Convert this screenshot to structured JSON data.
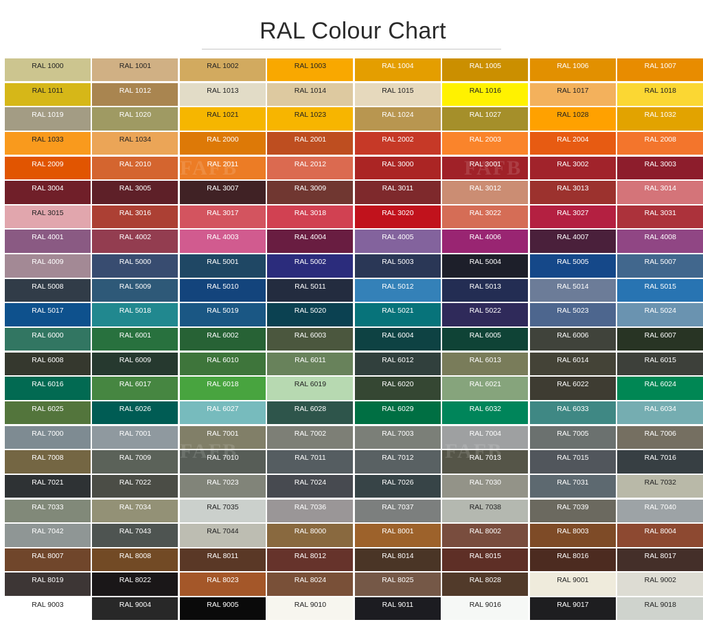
{
  "page": {
    "title": "RAL Colour Chart",
    "watermark_text": "FAFB"
  },
  "swatches": [
    {
      "label": "RAL 1000",
      "color": "#ccc58f",
      "text": "#222222"
    },
    {
      "label": "RAL 1001",
      "color": "#d0b084",
      "text": "#222222"
    },
    {
      "label": "RAL 1002",
      "color": "#d2aa5f",
      "text": "#222222"
    },
    {
      "label": "RAL 1003",
      "color": "#f9a800",
      "text": "#222222"
    },
    {
      "label": "RAL 1004",
      "color": "#e49e00",
      "text": "#ffffff"
    },
    {
      "label": "RAL 1005",
      "color": "#cb8f00",
      "text": "#ffffff"
    },
    {
      "label": "RAL 1006",
      "color": "#e29000",
      "text": "#ffffff"
    },
    {
      "label": "RAL 1007",
      "color": "#e88c00",
      "text": "#ffffff"
    },
    {
      "label": "RAL 1011",
      "color": "#d6b718",
      "text": "#222222"
    },
    {
      "label": "RAL 1012",
      "color": "#a98550",
      "text": "#ffffff"
    },
    {
      "label": "RAL 1013",
      "color": "#e2dcc7",
      "text": "#222222"
    },
    {
      "label": "RAL 1014",
      "color": "#ddc9a0",
      "text": "#222222"
    },
    {
      "label": "RAL 1015",
      "color": "#e6d9bd",
      "text": "#222222"
    },
    {
      "label": "RAL 1016",
      "color": "#fff200",
      "text": "#222222"
    },
    {
      "label": "RAL 1017",
      "color": "#f3b15c",
      "text": "#222222"
    },
    {
      "label": "RAL 1018",
      "color": "#fbd733",
      "text": "#222222"
    },
    {
      "label": "RAL 1019",
      "color": "#a39c84",
      "text": "#ffffff"
    },
    {
      "label": "RAL 1020",
      "color": "#9f9a63",
      "text": "#ffffff"
    },
    {
      "label": "RAL 1021",
      "color": "#f6b600",
      "text": "#222222"
    },
    {
      "label": "RAL 1023",
      "color": "#f7b500",
      "text": "#222222"
    },
    {
      "label": "RAL 1024",
      "color": "#b89650",
      "text": "#ffffff"
    },
    {
      "label": "RAL 1027",
      "color": "#a58f2a",
      "text": "#ffffff"
    },
    {
      "label": "RAL 1028",
      "color": "#ffa100",
      "text": "#222222"
    },
    {
      "label": "RAL 1032",
      "color": "#e2a300",
      "text": "#ffffff"
    },
    {
      "label": "RAL 1033",
      "color": "#f99a1d",
      "text": "#222222"
    },
    {
      "label": "RAL 1034",
      "color": "#eba557",
      "text": "#222222"
    },
    {
      "label": "RAL 2000",
      "color": "#dd7907",
      "text": "#ffffff"
    },
    {
      "label": "RAL 2001",
      "color": "#be4e20",
      "text": "#ffffff"
    },
    {
      "label": "RAL 2002",
      "color": "#c63927",
      "text": "#ffffff"
    },
    {
      "label": "RAL 2003",
      "color": "#fa842b",
      "text": "#ffffff"
    },
    {
      "label": "RAL 2004",
      "color": "#e75b12",
      "text": "#ffffff"
    },
    {
      "label": "RAL 2008",
      "color": "#f3752c",
      "text": "#ffffff"
    },
    {
      "label": "RAL 2009",
      "color": "#e15501",
      "text": "#ffffff"
    },
    {
      "label": "RAL 2010",
      "color": "#d4652f",
      "text": "#ffffff"
    },
    {
      "label": "RAL 2011",
      "color": "#ec7c25",
      "text": "#ffffff"
    },
    {
      "label": "RAL 2012",
      "color": "#db6a50",
      "text": "#ffffff"
    },
    {
      "label": "RAL 3000",
      "color": "#ab2524",
      "text": "#ffffff"
    },
    {
      "label": "RAL 3001",
      "color": "#a02128",
      "text": "#ffffff"
    },
    {
      "label": "RAL 3002",
      "color": "#a1232b",
      "text": "#ffffff"
    },
    {
      "label": "RAL 3003",
      "color": "#8d1d2c",
      "text": "#ffffff"
    },
    {
      "label": "RAL 3004",
      "color": "#701f29",
      "text": "#ffffff"
    },
    {
      "label": "RAL 3005",
      "color": "#5e2028",
      "text": "#ffffff"
    },
    {
      "label": "RAL 3007",
      "color": "#402225",
      "text": "#ffffff"
    },
    {
      "label": "RAL 3009",
      "color": "#703731",
      "text": "#ffffff"
    },
    {
      "label": "RAL 3011",
      "color": "#7e292c",
      "text": "#ffffff"
    },
    {
      "label": "RAL 3012",
      "color": "#cb8d73",
      "text": "#ffffff"
    },
    {
      "label": "RAL 3013",
      "color": "#9c322e",
      "text": "#ffffff"
    },
    {
      "label": "RAL 3014",
      "color": "#d47479",
      "text": "#ffffff"
    },
    {
      "label": "RAL 3015",
      "color": "#e1a6ad",
      "text": "#222222"
    },
    {
      "label": "RAL 3016",
      "color": "#ac4034",
      "text": "#ffffff"
    },
    {
      "label": "RAL 3017",
      "color": "#d3545f",
      "text": "#ffffff"
    },
    {
      "label": "RAL 3018",
      "color": "#d14152",
      "text": "#ffffff"
    },
    {
      "label": "RAL 3020",
      "color": "#c1121c",
      "text": "#ffffff"
    },
    {
      "label": "RAL 3022",
      "color": "#d56d56",
      "text": "#ffffff"
    },
    {
      "label": "RAL 3027",
      "color": "#b42041",
      "text": "#ffffff"
    },
    {
      "label": "RAL 3031",
      "color": "#ac323b",
      "text": "#ffffff"
    },
    {
      "label": "RAL 4001",
      "color": "#8a5a83",
      "text": "#ffffff"
    },
    {
      "label": "RAL 4002",
      "color": "#933d50",
      "text": "#ffffff"
    },
    {
      "label": "RAL 4003",
      "color": "#d15b8f",
      "text": "#ffffff"
    },
    {
      "label": "RAL 4004",
      "color": "#691d41",
      "text": "#ffffff"
    },
    {
      "label": "RAL 4005",
      "color": "#83639d",
      "text": "#ffffff"
    },
    {
      "label": "RAL 4006",
      "color": "#992572",
      "text": "#ffffff"
    },
    {
      "label": "RAL 4007",
      "color": "#4a203b",
      "text": "#ffffff"
    },
    {
      "label": "RAL 4008",
      "color": "#904684",
      "text": "#ffffff"
    },
    {
      "label": "RAL 4009",
      "color": "#a38995",
      "text": "#ffffff"
    },
    {
      "label": "RAL 5000",
      "color": "#384c70",
      "text": "#ffffff"
    },
    {
      "label": "RAL 5001",
      "color": "#1f4764",
      "text": "#ffffff"
    },
    {
      "label": "RAL 5002",
      "color": "#2b2c7c",
      "text": "#ffffff"
    },
    {
      "label": "RAL 5003",
      "color": "#2a3756",
      "text": "#ffffff"
    },
    {
      "label": "RAL 5004",
      "color": "#1d1f2a",
      "text": "#ffffff"
    },
    {
      "label": "RAL 5005",
      "color": "#154889",
      "text": "#ffffff"
    },
    {
      "label": "RAL 5007",
      "color": "#41678d",
      "text": "#ffffff"
    },
    {
      "label": "RAL 5008",
      "color": "#313c48",
      "text": "#ffffff"
    },
    {
      "label": "RAL 5009",
      "color": "#2e5978",
      "text": "#ffffff"
    },
    {
      "label": "RAL 5010",
      "color": "#13447c",
      "text": "#ffffff"
    },
    {
      "label": "RAL 5011",
      "color": "#232c3f",
      "text": "#ffffff"
    },
    {
      "label": "RAL 5012",
      "color": "#3481b8",
      "text": "#ffffff"
    },
    {
      "label": "RAL 5013",
      "color": "#232d53",
      "text": "#ffffff"
    },
    {
      "label": "RAL 5014",
      "color": "#6c7c98",
      "text": "#ffffff"
    },
    {
      "label": "RAL 5015",
      "color": "#2874b2",
      "text": "#ffffff"
    },
    {
      "label": "RAL 5017",
      "color": "#0e518d",
      "text": "#ffffff"
    },
    {
      "label": "RAL 5018",
      "color": "#21888f",
      "text": "#ffffff"
    },
    {
      "label": "RAL 5019",
      "color": "#1a5784",
      "text": "#ffffff"
    },
    {
      "label": "RAL 5020",
      "color": "#0b4151",
      "text": "#ffffff"
    },
    {
      "label": "RAL 5021",
      "color": "#07737a",
      "text": "#ffffff"
    },
    {
      "label": "RAL 5022",
      "color": "#2f2a5a",
      "text": "#ffffff"
    },
    {
      "label": "RAL 5023",
      "color": "#4d668e",
      "text": "#ffffff"
    },
    {
      "label": "RAL 5024",
      "color": "#6a93b0",
      "text": "#ffffff"
    },
    {
      "label": "RAL 6000",
      "color": "#327662",
      "text": "#ffffff"
    },
    {
      "label": "RAL 6001",
      "color": "#28713e",
      "text": "#ffffff"
    },
    {
      "label": "RAL 6002",
      "color": "#276235",
      "text": "#ffffff"
    },
    {
      "label": "RAL 6003",
      "color": "#4b573e",
      "text": "#ffffff"
    },
    {
      "label": "RAL 6004",
      "color": "#0e4243",
      "text": "#ffffff"
    },
    {
      "label": "RAL 6005",
      "color": "#0f4336",
      "text": "#ffffff"
    },
    {
      "label": "RAL 6006",
      "color": "#40433b",
      "text": "#ffffff"
    },
    {
      "label": "RAL 6007",
      "color": "#283424",
      "text": "#ffffff"
    },
    {
      "label": "RAL 6008",
      "color": "#35382e",
      "text": "#ffffff"
    },
    {
      "label": "RAL 6009",
      "color": "#26392f",
      "text": "#ffffff"
    },
    {
      "label": "RAL 6010",
      "color": "#3e753b",
      "text": "#ffffff"
    },
    {
      "label": "RAL 6011",
      "color": "#68825b",
      "text": "#ffffff"
    },
    {
      "label": "RAL 6012",
      "color": "#31403d",
      "text": "#ffffff"
    },
    {
      "label": "RAL 6013",
      "color": "#797c5a",
      "text": "#ffffff"
    },
    {
      "label": "RAL 6014",
      "color": "#444337",
      "text": "#ffffff"
    },
    {
      "label": "RAL 6015",
      "color": "#3d403a",
      "text": "#ffffff"
    },
    {
      "label": "RAL 6016",
      "color": "#026a52",
      "text": "#ffffff"
    },
    {
      "label": "RAL 6017",
      "color": "#468641",
      "text": "#ffffff"
    },
    {
      "label": "RAL 6018",
      "color": "#48a43f",
      "text": "#ffffff"
    },
    {
      "label": "RAL 6019",
      "color": "#b7d9b1",
      "text": "#222222"
    },
    {
      "label": "RAL 6020",
      "color": "#354733",
      "text": "#ffffff"
    },
    {
      "label": "RAL 6021",
      "color": "#86a47c",
      "text": "#ffffff"
    },
    {
      "label": "RAL 6022",
      "color": "#3e3c32",
      "text": "#ffffff"
    },
    {
      "label": "RAL 6024",
      "color": "#008754",
      "text": "#ffffff"
    },
    {
      "label": "RAL 6025",
      "color": "#53753c",
      "text": "#ffffff"
    },
    {
      "label": "RAL 6026",
      "color": "#005c54",
      "text": "#ffffff"
    },
    {
      "label": "RAL 6027",
      "color": "#77bbbd",
      "text": "#ffffff"
    },
    {
      "label": "RAL 6028",
      "color": "#2e554b",
      "text": "#ffffff"
    },
    {
      "label": "RAL 6029",
      "color": "#006f43",
      "text": "#ffffff"
    },
    {
      "label": "RAL 6032",
      "color": "#00855a",
      "text": "#ffffff"
    },
    {
      "label": "RAL 6033",
      "color": "#3f8884",
      "text": "#ffffff"
    },
    {
      "label": "RAL 6034",
      "color": "#75adb1",
      "text": "#ffffff"
    },
    {
      "label": "RAL 7000",
      "color": "#7e8b92",
      "text": "#ffffff"
    },
    {
      "label": "RAL 7001",
      "color": "#8f999f",
      "text": "#ffffff"
    },
    {
      "label": "RAL 7001",
      "color": "#817f68",
      "text": "#ffffff"
    },
    {
      "label": "RAL 7002",
      "color": "#7d7f76",
      "text": "#ffffff"
    },
    {
      "label": "RAL 7003",
      "color": "#7b7f78",
      "text": "#ffffff"
    },
    {
      "label": "RAL 7004",
      "color": "#9ea0a1",
      "text": "#ffffff"
    },
    {
      "label": "RAL 7005",
      "color": "#6b716f",
      "text": "#ffffff"
    },
    {
      "label": "RAL 7006",
      "color": "#756f61",
      "text": "#ffffff"
    },
    {
      "label": "RAL 7008",
      "color": "#746643",
      "text": "#ffffff"
    },
    {
      "label": "RAL 7009",
      "color": "#5b6259",
      "text": "#ffffff"
    },
    {
      "label": "RAL 7010",
      "color": "#575d57",
      "text": "#ffffff"
    },
    {
      "label": "RAL 7011",
      "color": "#555d61",
      "text": "#ffffff"
    },
    {
      "label": "RAL 7012",
      "color": "#596163",
      "text": "#ffffff"
    },
    {
      "label": "RAL 7013",
      "color": "#555548",
      "text": "#ffffff"
    },
    {
      "label": "RAL 7015",
      "color": "#51565c",
      "text": "#ffffff"
    },
    {
      "label": "RAL 7016",
      "color": "#373f43",
      "text": "#ffffff"
    },
    {
      "label": "RAL 7021",
      "color": "#2e3234",
      "text": "#ffffff"
    },
    {
      "label": "RAL 7022",
      "color": "#4b4d46",
      "text": "#ffffff"
    },
    {
      "label": "RAL 7023",
      "color": "#818479",
      "text": "#ffffff"
    },
    {
      "label": "RAL 7024",
      "color": "#474a50",
      "text": "#ffffff"
    },
    {
      "label": "RAL 7026",
      "color": "#374447",
      "text": "#ffffff"
    },
    {
      "label": "RAL 7030",
      "color": "#939388",
      "text": "#ffffff"
    },
    {
      "label": "RAL 7031",
      "color": "#5d6970",
      "text": "#ffffff"
    },
    {
      "label": "RAL 7032",
      "color": "#b9b9a8",
      "text": "#222222"
    },
    {
      "label": "RAL 7033",
      "color": "#818979",
      "text": "#ffffff"
    },
    {
      "label": "RAL 7034",
      "color": "#939176",
      "text": "#ffffff"
    },
    {
      "label": "RAL 7035",
      "color": "#cbd0cc",
      "text": "#222222"
    },
    {
      "label": "RAL 7036",
      "color": "#9a9697",
      "text": "#ffffff"
    },
    {
      "label": "RAL 7037",
      "color": "#7c7f7e",
      "text": "#ffffff"
    },
    {
      "label": "RAL 7038",
      "color": "#b4b8b0",
      "text": "#222222"
    },
    {
      "label": "RAL 7039",
      "color": "#6b695f",
      "text": "#ffffff"
    },
    {
      "label": "RAL 7040",
      "color": "#9da3a6",
      "text": "#ffffff"
    },
    {
      "label": "RAL 7042",
      "color": "#8f9695",
      "text": "#ffffff"
    },
    {
      "label": "RAL 7043",
      "color": "#4e5451",
      "text": "#ffffff"
    },
    {
      "label": "RAL 7044",
      "color": "#bdbdb2",
      "text": "#222222"
    },
    {
      "label": "RAL 8000",
      "color": "#89693f",
      "text": "#ffffff"
    },
    {
      "label": "RAL 8001",
      "color": "#9d622b",
      "text": "#ffffff"
    },
    {
      "label": "RAL 8002",
      "color": "#794d3e",
      "text": "#ffffff"
    },
    {
      "label": "RAL 8003",
      "color": "#7e4b27",
      "text": "#ffffff"
    },
    {
      "label": "RAL 8004",
      "color": "#8d4931",
      "text": "#ffffff"
    },
    {
      "label": "RAL 8007",
      "color": "#70462b",
      "text": "#ffffff"
    },
    {
      "label": "RAL 8008",
      "color": "#724a25",
      "text": "#ffffff"
    },
    {
      "label": "RAL 8011",
      "color": "#5a3826",
      "text": "#ffffff"
    },
    {
      "label": "RAL 8012",
      "color": "#66332b",
      "text": "#ffffff"
    },
    {
      "label": "RAL 8014",
      "color": "#4a3526",
      "text": "#ffffff"
    },
    {
      "label": "RAL 8015",
      "color": "#5e2f26",
      "text": "#ffffff"
    },
    {
      "label": "RAL 8016",
      "color": "#4c2b20",
      "text": "#ffffff"
    },
    {
      "label": "RAL 8017",
      "color": "#442f29",
      "text": "#ffffff"
    },
    {
      "label": "RAL 8019",
      "color": "#3d3635",
      "text": "#ffffff"
    },
    {
      "label": "RAL 8022",
      "color": "#1a1718",
      "text": "#ffffff"
    },
    {
      "label": "RAL 8023",
      "color": "#a45729",
      "text": "#ffffff"
    },
    {
      "label": "RAL 8024",
      "color": "#795038",
      "text": "#ffffff"
    },
    {
      "label": "RAL 8025",
      "color": "#755847",
      "text": "#ffffff"
    },
    {
      "label": "RAL 8028",
      "color": "#513a2a",
      "text": "#ffffff"
    },
    {
      "label": "RAL 9001",
      "color": "#efebdc",
      "text": "#222222"
    },
    {
      "label": "RAL 9002",
      "color": "#dddcd3",
      "text": "#222222"
    },
    {
      "label": "RAL 9003",
      "color": "#ffffff",
      "text": "#222222"
    },
    {
      "label": "RAL 9004",
      "color": "#282828",
      "text": "#ffffff"
    },
    {
      "label": "RAL 9005",
      "color": "#0a0a0a",
      "text": "#ffffff"
    },
    {
      "label": "RAL 9010",
      "color": "#f7f6ef",
      "text": "#222222"
    },
    {
      "label": "RAL 9011",
      "color": "#1c1c21",
      "text": "#ffffff"
    },
    {
      "label": "RAL 9016",
      "color": "#f6f8f6",
      "text": "#222222"
    },
    {
      "label": "RAL 9017",
      "color": "#1e1e20",
      "text": "#ffffff"
    },
    {
      "label": "RAL 9018",
      "color": "#cfd3cd",
      "text": "#222222"
    }
  ]
}
